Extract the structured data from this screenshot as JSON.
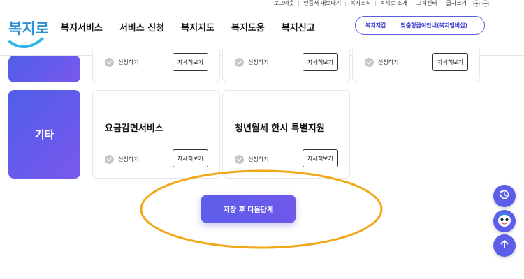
{
  "utility_bar": {
    "items": [
      "로그아웃",
      "인증서 내보내기",
      "복지소식",
      "복지로 소개",
      "고객센터",
      "글자크기"
    ],
    "zoom_in": "+",
    "zoom_out": "−"
  },
  "header": {
    "logo_text": "복지로",
    "nav": [
      "복지서비스",
      "서비스 신청",
      "복지지도",
      "복지도움",
      "복지신고"
    ],
    "pill_left": "복지지갑",
    "pill_right": "맞춤형급여안내(복지멤버십)"
  },
  "categories": {
    "top_label": "",
    "etc_label": "기타"
  },
  "cards_top": [
    {
      "apply": "신청하기",
      "detail": "자세히보기"
    },
    {
      "apply": "신청하기",
      "detail": "자세히보기"
    },
    {
      "apply": "신청하기",
      "detail": "자세히보기"
    }
  ],
  "cards_etc": [
    {
      "title": "요금감면서비스",
      "apply": "신청하기",
      "detail": "자세히보기"
    },
    {
      "title": "청년월세 한시 특별지원",
      "apply": "신청하기",
      "detail": "자세히보기"
    }
  ],
  "save_button": "저장 후 다음단계",
  "colors": {
    "accent": "#5c5ee9",
    "highlight": "#f0a81a",
    "check_gray": "#c7c7c7"
  },
  "icons": {
    "fab_history": "history-icon",
    "fab_chatbot": "chatbot-icon",
    "fab_top": "arrow-up-icon"
  }
}
